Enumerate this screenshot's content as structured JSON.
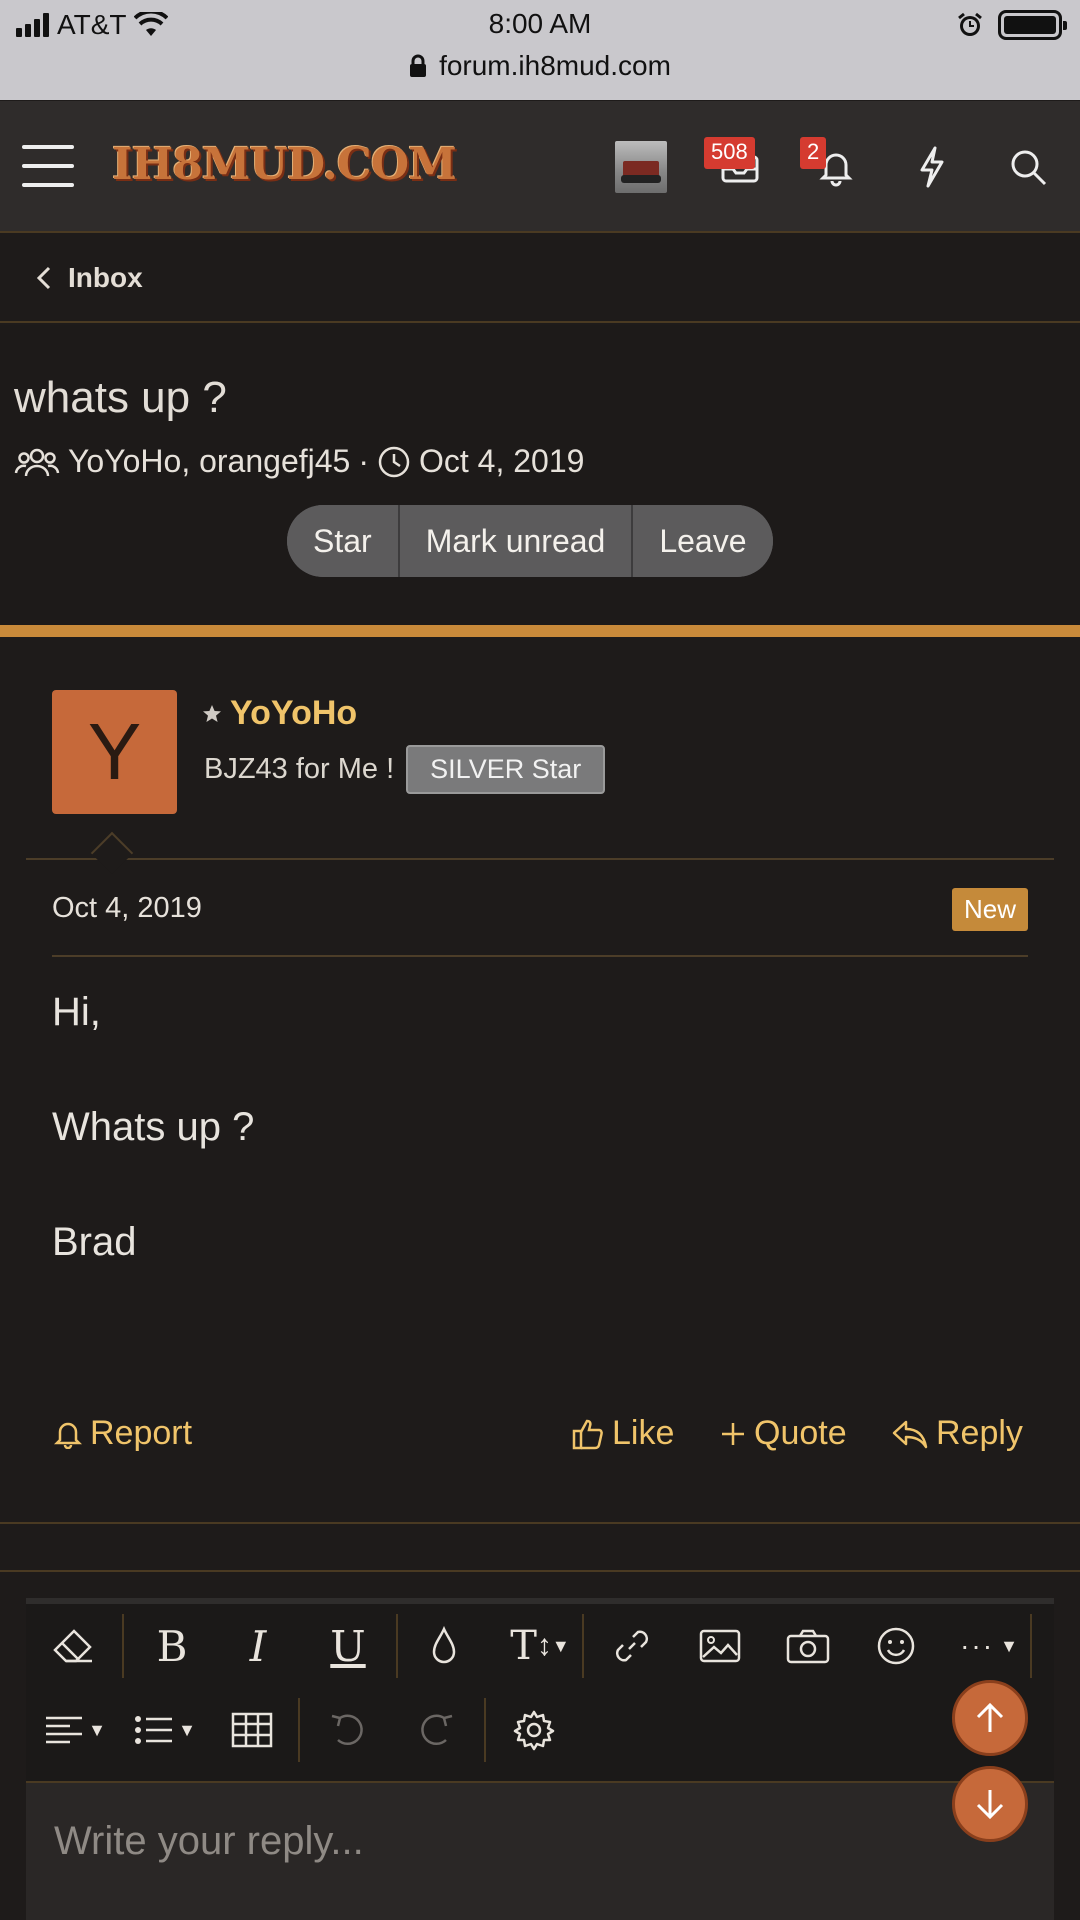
{
  "status_bar": {
    "carrier": "AT&T",
    "time": "8:00 AM",
    "url": "forum.ih8mud.com"
  },
  "header": {
    "logo_text": "IH8MUD.COM",
    "conversations_count": "508",
    "alerts_count": "2"
  },
  "breadcrumb": {
    "label": "Inbox"
  },
  "conversation": {
    "title": "whats up ?",
    "participants": "YoYoHo, orangefj45",
    "separator": "·",
    "date": "Oct 4, 2019",
    "buttons": {
      "star": "Star",
      "mark_unread": "Mark unread",
      "leave": "Leave"
    }
  },
  "message": {
    "avatar_letter": "Y",
    "username": "YoYoHo",
    "user_title": "BJZ43 for Me !",
    "rank": "SILVER Star",
    "date": "Oct 4, 2019",
    "new_label": "New",
    "body": [
      "Hi,",
      "Whats up ?",
      "Brad"
    ],
    "actions": {
      "report": "Report",
      "like": "Like",
      "quote": "Quote",
      "reply": "Reply"
    }
  },
  "editor": {
    "placeholder": "Write your reply...",
    "toolbar_icons": [
      "eraser-icon",
      "bold-icon",
      "italic-icon",
      "underline-icon",
      "text-color-icon",
      "font-size-icon",
      "link-icon",
      "image-icon",
      "camera-icon",
      "smiley-icon",
      "more-icon",
      "align-icon",
      "list-icon",
      "table-icon",
      "undo-icon",
      "redo-icon",
      "settings-icon"
    ]
  },
  "colors": {
    "accent": "#f0c46a",
    "rule_orange": "#c98a3a",
    "badge_red": "#d53b30",
    "avatar_orange": "#c6693a"
  }
}
